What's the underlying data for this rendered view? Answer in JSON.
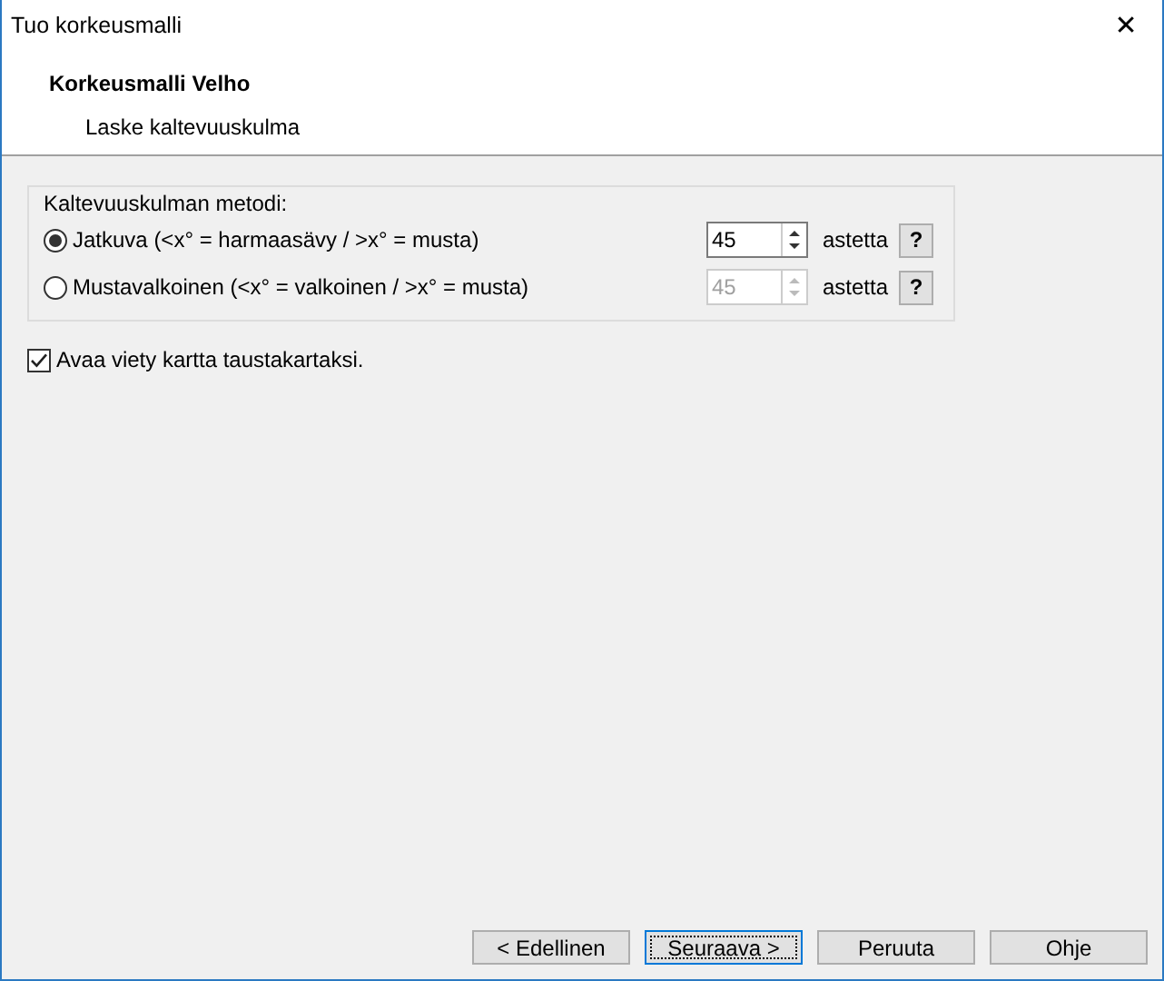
{
  "window": {
    "title": "Tuo korkeusmalli",
    "close": "✕"
  },
  "header": {
    "title": "Korkeusmalli Velho",
    "subtitle": "Laske kaltevuuskulma"
  },
  "method_group": {
    "legend": "Kaltevuuskulman metodi:",
    "options": [
      {
        "label": "Jatkuva (<x° = harmaasävy / >x° = musta)",
        "selected": true,
        "value": "45",
        "unit": "astetta",
        "disabled": false,
        "help": "?"
      },
      {
        "label": "Mustavalkoinen (<x° = valkoinen / >x° = musta)",
        "selected": false,
        "value": "45",
        "unit": "astetta",
        "disabled": true,
        "help": "?"
      }
    ]
  },
  "open_checkbox": {
    "label": "Avaa viety kartta taustakartaksi.",
    "checked": true
  },
  "buttons": [
    {
      "label": "< Edellinen",
      "default": false
    },
    {
      "label": "Seuraava >",
      "default": true
    },
    {
      "label": "Peruuta",
      "default": false
    },
    {
      "label": "Ohje",
      "default": false
    }
  ]
}
